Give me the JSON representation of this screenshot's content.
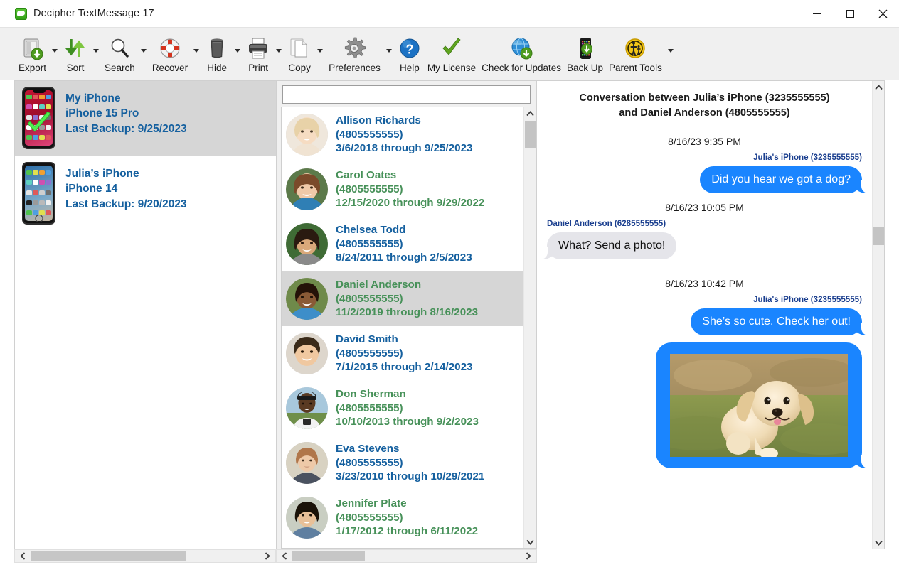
{
  "window": {
    "title": "Decipher TextMessage 17",
    "app_icon": "message-bubble-icon",
    "minimize": "minimize",
    "maximize": "maximize",
    "close": "close"
  },
  "toolbar": {
    "items": [
      {
        "label": "Export",
        "icon": "export-icon",
        "has_caret": true
      },
      {
        "label": "Sort",
        "icon": "sort-arrows-icon",
        "has_caret": true
      },
      {
        "label": "Search",
        "icon": "magnifier-icon",
        "has_caret": true
      },
      {
        "label": "Recover",
        "icon": "lifesaver-icon",
        "has_caret": true
      },
      {
        "label": "Hide",
        "icon": "trash-can-icon",
        "has_caret": true
      },
      {
        "label": "Print",
        "icon": "printer-icon",
        "has_caret": true
      },
      {
        "label": "Copy",
        "icon": "copy-pages-icon",
        "has_caret": true
      },
      {
        "label": "Preferences",
        "icon": "gear-icon",
        "has_caret": true
      },
      {
        "label": "Help",
        "icon": "help-question-icon",
        "has_caret": false
      },
      {
        "label": "My License",
        "icon": "green-check-icon",
        "has_caret": false
      },
      {
        "label": "Check for Updates",
        "icon": "globe-download-icon",
        "has_caret": false
      },
      {
        "label": "Back Up",
        "icon": "phone-backup-icon",
        "has_caret": false
      },
      {
        "label": "Parent Tools",
        "icon": "parent-child-icon",
        "has_caret": true
      }
    ]
  },
  "devices": {
    "items": [
      {
        "name": "My iPhone",
        "model": "iPhone 15 Pro",
        "backup": "Last Backup: 9/25/2023",
        "selected": true,
        "checked": true
      },
      {
        "name": "Julia’s iPhone",
        "model": "iPhone 14",
        "backup": "Last Backup: 9/20/2023",
        "selected": false,
        "checked": false
      }
    ]
  },
  "search": {
    "value": "",
    "placeholder": ""
  },
  "contacts": {
    "items": [
      {
        "name": "Allison Richards",
        "phone": "(4805555555)",
        "range": "3/6/2018 through 9/25/2023",
        "color": "#15609f",
        "selected": false
      },
      {
        "name": "Carol Oates",
        "phone": "(4805555555)",
        "range": "12/15/2020 through 9/29/2022",
        "color": "#479159",
        "selected": false
      },
      {
        "name": "Chelsea Todd",
        "phone": "(4805555555)",
        "range": "8/24/2011 through 2/5/2023",
        "color": "#15609f",
        "selected": false
      },
      {
        "name": "Daniel Anderson",
        "phone": "(4805555555)",
        "range": "11/2/2019 through 8/16/2023",
        "color": "#479159",
        "selected": true
      },
      {
        "name": "David Smith",
        "phone": "(4805555555)",
        "range": "7/1/2015 through 2/14/2023",
        "color": "#15609f",
        "selected": false
      },
      {
        "name": "Don Sherman",
        "phone": "(4805555555)",
        "range": "10/10/2013 through 9/2/2023",
        "color": "#479159",
        "selected": false
      },
      {
        "name": "Eva Stevens",
        "phone": "(4805555555)",
        "range": "3/23/2010 through 10/29/2021",
        "color": "#15609f",
        "selected": false
      },
      {
        "name": "Jennifer Plate",
        "phone": "(4805555555)",
        "range": "1/17/2012 through 6/11/2022",
        "color": "#479159",
        "selected": false
      }
    ]
  },
  "conversation": {
    "title_line1": "Conversation between Julia’s iPhone (3235555555)",
    "title_line2": "and Daniel Anderson (4805555555)",
    "messages": [
      {
        "timestamp": "8/16/23 9:35 PM",
        "sender": "Julia's iPhone (3235555555)",
        "direction": "out",
        "text": "Did you hear we got a dog?"
      },
      {
        "timestamp": "8/16/23 10:05 PM",
        "sender": "Daniel Anderson (6285555555)",
        "direction": "in",
        "text": "What? Send a photo!"
      },
      {
        "timestamp": "8/16/23 10:42 PM",
        "sender": "Julia's iPhone (3235555555)",
        "direction": "out",
        "text": "She’s so cute. Check her out!"
      },
      {
        "timestamp": "",
        "sender": "",
        "direction": "out",
        "text": "",
        "attachment": "golden-retriever-puppy-photo"
      }
    ]
  },
  "colors": {
    "accent_blue": "#15609f",
    "accent_green": "#479159",
    "bubble_out": "#1a85ff",
    "bubble_in": "#e5e5ea",
    "sender_label": "#1b3f8f",
    "toolbar_bg": "#f0f0f0",
    "selection": "#d6d6d6"
  }
}
